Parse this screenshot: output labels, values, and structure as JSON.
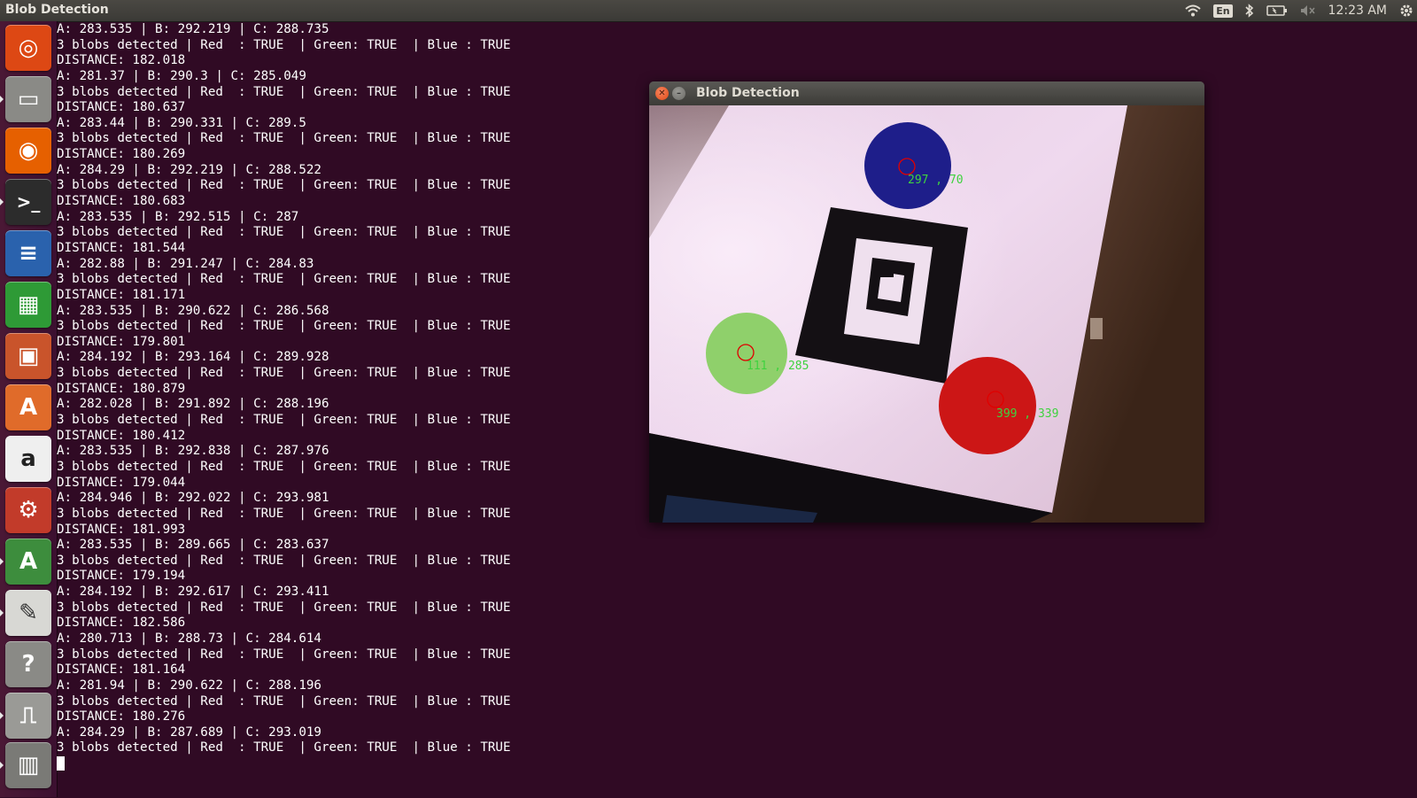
{
  "top_panel": {
    "app_title": "Blob Detection",
    "keyboard_lang": "En",
    "clock": "12:23 AM",
    "icons": [
      "wifi-icon",
      "keyboard-layout-icon",
      "bluetooth-icon",
      "battery-icon",
      "volume-muted-icon",
      "settings-gear-icon"
    ]
  },
  "launcher": {
    "items": [
      {
        "name": "ubuntu-dash-icon",
        "color": "#dd4814"
      },
      {
        "name": "files-icon",
        "color": "#8a8a86"
      },
      {
        "name": "firefox-icon",
        "color": "#e66000"
      },
      {
        "name": "terminal-icon",
        "color": "#2c2c2c"
      },
      {
        "name": "libreoffice-writer-icon",
        "color": "#2a62ad"
      },
      {
        "name": "libreoffice-calc-icon",
        "color": "#2e9a36"
      },
      {
        "name": "libreoffice-impress-icon",
        "color": "#c9542b"
      },
      {
        "name": "software-center-icon",
        "color": "#e06b2a"
      },
      {
        "name": "amazon-icon",
        "color": "#efefef"
      },
      {
        "name": "system-settings-icon",
        "color": "#c23b2a"
      },
      {
        "name": "software-updater-icon",
        "color": "#3d8d3d"
      },
      {
        "name": "text-editor-icon",
        "color": "#d8d8d4"
      },
      {
        "name": "help-icon",
        "color": "#8a8a86"
      },
      {
        "name": "usb-drive-icon",
        "color": "#9a9a96"
      },
      {
        "name": "trash-icon",
        "color": "#7a7a76"
      }
    ]
  },
  "terminal": {
    "lines": [
      "A: 283.535 | B: 292.219 | C: 288.735",
      "3 blobs detected | Red  : TRUE  | Green: TRUE  | Blue : TRUE",
      "DISTANCE: 182.018",
      "A: 281.37 | B: 290.3 | C: 285.049",
      "3 blobs detected | Red  : TRUE  | Green: TRUE  | Blue : TRUE",
      "DISTANCE: 180.637",
      "A: 283.44 | B: 290.331 | C: 289.5",
      "3 blobs detected | Red  : TRUE  | Green: TRUE  | Blue : TRUE",
      "DISTANCE: 180.269",
      "A: 284.29 | B: 292.219 | C: 288.522",
      "3 blobs detected | Red  : TRUE  | Green: TRUE  | Blue : TRUE",
      "DISTANCE: 180.683",
      "A: 283.535 | B: 292.515 | C: 287",
      "3 blobs detected | Red  : TRUE  | Green: TRUE  | Blue : TRUE",
      "DISTANCE: 181.544",
      "A: 282.88 | B: 291.247 | C: 284.83",
      "3 blobs detected | Red  : TRUE  | Green: TRUE  | Blue : TRUE",
      "DISTANCE: 181.171",
      "A: 283.535 | B: 290.622 | C: 286.568",
      "3 blobs detected | Red  : TRUE  | Green: TRUE  | Blue : TRUE",
      "DISTANCE: 179.801",
      "A: 284.192 | B: 293.164 | C: 289.928",
      "3 blobs detected | Red  : TRUE  | Green: TRUE  | Blue : TRUE",
      "DISTANCE: 180.879",
      "A: 282.028 | B: 291.892 | C: 288.196",
      "3 blobs detected | Red  : TRUE  | Green: TRUE  | Blue : TRUE",
      "DISTANCE: 180.412",
      "A: 283.535 | B: 292.838 | C: 287.976",
      "3 blobs detected | Red  : TRUE  | Green: TRUE  | Blue : TRUE",
      "DISTANCE: 179.044",
      "A: 284.946 | B: 292.022 | C: 293.981",
      "3 blobs detected | Red  : TRUE  | Green: TRUE  | Blue : TRUE",
      "DISTANCE: 181.993",
      "A: 283.535 | B: 289.665 | C: 283.637",
      "3 blobs detected | Red  : TRUE  | Green: TRUE  | Blue : TRUE",
      "DISTANCE: 179.194",
      "A: 284.192 | B: 292.617 | C: 293.411",
      "3 blobs detected | Red  : TRUE  | Green: TRUE  | Blue : TRUE",
      "DISTANCE: 182.586",
      "A: 280.713 | B: 288.73 | C: 284.614",
      "3 blobs detected | Red  : TRUE  | Green: TRUE  | Blue : TRUE",
      "DISTANCE: 181.164",
      "A: 281.94 | B: 290.622 | C: 288.196",
      "3 blobs detected | Red  : TRUE  | Green: TRUE  | Blue : TRUE",
      "DISTANCE: 180.276",
      "A: 284.29 | B: 287.689 | C: 293.019",
      "3 blobs detected | Red  : TRUE  | Green: TRUE  | Blue : TRUE"
    ]
  },
  "blob_window": {
    "title": "Blob Detection",
    "overlays": {
      "blue": "297 , 70",
      "green": "111 , 285",
      "red": "399 , 339"
    },
    "colors": {
      "blue_blob": "#1e1e8a",
      "green_blob": "#8fd06b",
      "red_blob": "#cc1616",
      "label": "#3fd23f"
    }
  }
}
